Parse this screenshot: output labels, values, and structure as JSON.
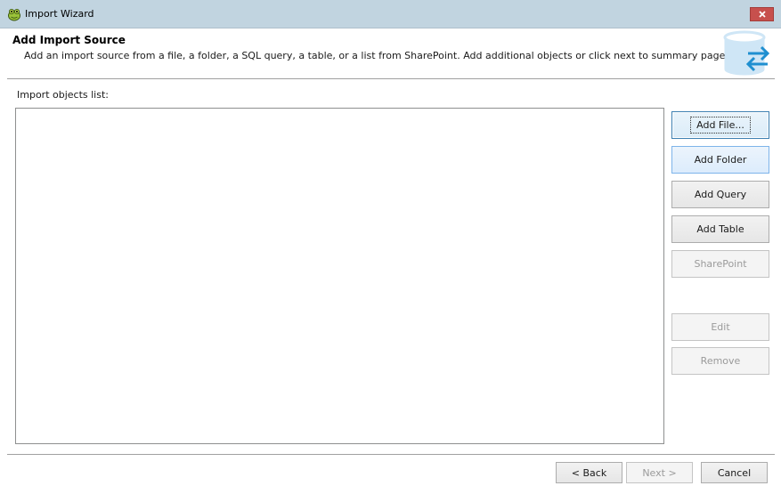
{
  "window": {
    "title": "Import Wizard",
    "close_icon": "close-icon",
    "app_icon": "frog-app-icon"
  },
  "header": {
    "title": "Add Import Source",
    "description": "Add an import source from a file, a folder, a SQL query, a table, or a list from SharePoint. Add additional objects or click next to summary page.",
    "icon": "database-transfer-icon"
  },
  "list": {
    "label": "Import objects list:",
    "items": []
  },
  "actions": {
    "add_file": "Add File...",
    "add_folder": "Add Folder",
    "add_query": "Add Query",
    "add_table": "Add Table",
    "sharepoint": "SharePoint",
    "edit": "Edit",
    "remove": "Remove"
  },
  "navigation": {
    "back": "< Back",
    "next": "Next >",
    "cancel": "Cancel"
  },
  "colors": {
    "titlebar": "#c1d4e0",
    "close_button": "#c7504d",
    "accent_blue": "#1f8fd0",
    "db_icon_fill": "#cfe6f6"
  }
}
